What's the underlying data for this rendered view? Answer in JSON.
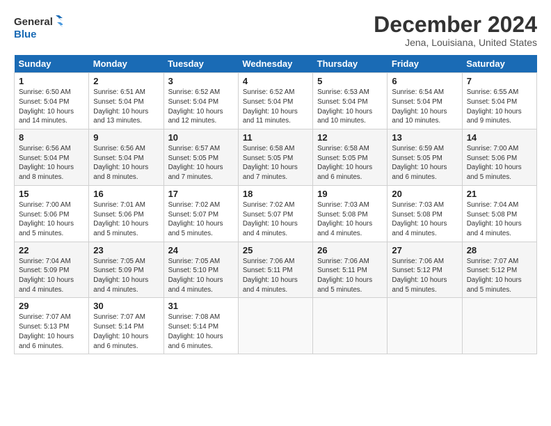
{
  "logo": {
    "line1": "General",
    "line2": "Blue"
  },
  "title": "December 2024",
  "subtitle": "Jena, Louisiana, United States",
  "days_of_week": [
    "Sunday",
    "Monday",
    "Tuesday",
    "Wednesday",
    "Thursday",
    "Friday",
    "Saturday"
  ],
  "weeks": [
    [
      {
        "day": "1",
        "sunrise": "6:50 AM",
        "sunset": "5:04 PM",
        "daylight": "10 hours and 14 minutes."
      },
      {
        "day": "2",
        "sunrise": "6:51 AM",
        "sunset": "5:04 PM",
        "daylight": "10 hours and 13 minutes."
      },
      {
        "day": "3",
        "sunrise": "6:52 AM",
        "sunset": "5:04 PM",
        "daylight": "10 hours and 12 minutes."
      },
      {
        "day": "4",
        "sunrise": "6:52 AM",
        "sunset": "5:04 PM",
        "daylight": "10 hours and 11 minutes."
      },
      {
        "day": "5",
        "sunrise": "6:53 AM",
        "sunset": "5:04 PM",
        "daylight": "10 hours and 10 minutes."
      },
      {
        "day": "6",
        "sunrise": "6:54 AM",
        "sunset": "5:04 PM",
        "daylight": "10 hours and 10 minutes."
      },
      {
        "day": "7",
        "sunrise": "6:55 AM",
        "sunset": "5:04 PM",
        "daylight": "10 hours and 9 minutes."
      }
    ],
    [
      {
        "day": "8",
        "sunrise": "6:56 AM",
        "sunset": "5:04 PM",
        "daylight": "10 hours and 8 minutes."
      },
      {
        "day": "9",
        "sunrise": "6:56 AM",
        "sunset": "5:04 PM",
        "daylight": "10 hours and 8 minutes."
      },
      {
        "day": "10",
        "sunrise": "6:57 AM",
        "sunset": "5:05 PM",
        "daylight": "10 hours and 7 minutes."
      },
      {
        "day": "11",
        "sunrise": "6:58 AM",
        "sunset": "5:05 PM",
        "daylight": "10 hours and 7 minutes."
      },
      {
        "day": "12",
        "sunrise": "6:58 AM",
        "sunset": "5:05 PM",
        "daylight": "10 hours and 6 minutes."
      },
      {
        "day": "13",
        "sunrise": "6:59 AM",
        "sunset": "5:05 PM",
        "daylight": "10 hours and 6 minutes."
      },
      {
        "day": "14",
        "sunrise": "7:00 AM",
        "sunset": "5:06 PM",
        "daylight": "10 hours and 5 minutes."
      }
    ],
    [
      {
        "day": "15",
        "sunrise": "7:00 AM",
        "sunset": "5:06 PM",
        "daylight": "10 hours and 5 minutes."
      },
      {
        "day": "16",
        "sunrise": "7:01 AM",
        "sunset": "5:06 PM",
        "daylight": "10 hours and 5 minutes."
      },
      {
        "day": "17",
        "sunrise": "7:02 AM",
        "sunset": "5:07 PM",
        "daylight": "10 hours and 5 minutes."
      },
      {
        "day": "18",
        "sunrise": "7:02 AM",
        "sunset": "5:07 PM",
        "daylight": "10 hours and 4 minutes."
      },
      {
        "day": "19",
        "sunrise": "7:03 AM",
        "sunset": "5:08 PM",
        "daylight": "10 hours and 4 minutes."
      },
      {
        "day": "20",
        "sunrise": "7:03 AM",
        "sunset": "5:08 PM",
        "daylight": "10 hours and 4 minutes."
      },
      {
        "day": "21",
        "sunrise": "7:04 AM",
        "sunset": "5:08 PM",
        "daylight": "10 hours and 4 minutes."
      }
    ],
    [
      {
        "day": "22",
        "sunrise": "7:04 AM",
        "sunset": "5:09 PM",
        "daylight": "10 hours and 4 minutes."
      },
      {
        "day": "23",
        "sunrise": "7:05 AM",
        "sunset": "5:09 PM",
        "daylight": "10 hours and 4 minutes."
      },
      {
        "day": "24",
        "sunrise": "7:05 AM",
        "sunset": "5:10 PM",
        "daylight": "10 hours and 4 minutes."
      },
      {
        "day": "25",
        "sunrise": "7:06 AM",
        "sunset": "5:11 PM",
        "daylight": "10 hours and 4 minutes."
      },
      {
        "day": "26",
        "sunrise": "7:06 AM",
        "sunset": "5:11 PM",
        "daylight": "10 hours and 5 minutes."
      },
      {
        "day": "27",
        "sunrise": "7:06 AM",
        "sunset": "5:12 PM",
        "daylight": "10 hours and 5 minutes."
      },
      {
        "day": "28",
        "sunrise": "7:07 AM",
        "sunset": "5:12 PM",
        "daylight": "10 hours and 5 minutes."
      }
    ],
    [
      {
        "day": "29",
        "sunrise": "7:07 AM",
        "sunset": "5:13 PM",
        "daylight": "10 hours and 6 minutes."
      },
      {
        "day": "30",
        "sunrise": "7:07 AM",
        "sunset": "5:14 PM",
        "daylight": "10 hours and 6 minutes."
      },
      {
        "day": "31",
        "sunrise": "7:08 AM",
        "sunset": "5:14 PM",
        "daylight": "10 hours and 6 minutes."
      },
      null,
      null,
      null,
      null
    ]
  ]
}
